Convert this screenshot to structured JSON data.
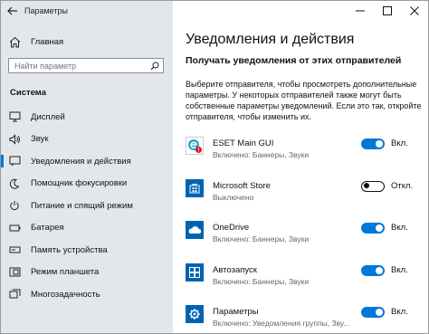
{
  "window": {
    "title": "Параметры"
  },
  "sidebar": {
    "home_label": "Главная",
    "search_placeholder": "Найти параметр",
    "section_title": "Система",
    "items": [
      {
        "label": "Дисплей",
        "icon": "display-icon",
        "active": false
      },
      {
        "label": "Звук",
        "icon": "sound-icon",
        "active": false
      },
      {
        "label": "Уведомления и действия",
        "icon": "notifications-icon",
        "active": true
      },
      {
        "label": "Помощник фокусировки",
        "icon": "focus-assist-icon",
        "active": false
      },
      {
        "label": "Питание и спящий режим",
        "icon": "power-icon",
        "active": false
      },
      {
        "label": "Батарея",
        "icon": "battery-icon",
        "active": false
      },
      {
        "label": "Память устройства",
        "icon": "storage-icon",
        "active": false
      },
      {
        "label": "Режим планшета",
        "icon": "tablet-mode-icon",
        "active": false
      },
      {
        "label": "Многозадачность",
        "icon": "multitasking-icon",
        "active": false
      }
    ]
  },
  "main": {
    "title": "Уведомления и действия",
    "subtitle": "Получать уведомления от этих отправителей",
    "description": "Выберите отправителя, чтобы просмотреть дополнительные параметры. У некоторых отправителей также могут быть собственные параметры уведомлений. Если это так, откройте отправителя, чтобы изменить их.",
    "apps": [
      {
        "name": "ESET Main GUI",
        "status": "Включено: Баннеры, Звуки",
        "toggle": "Вкл.",
        "on": true,
        "icon": "eset-icon"
      },
      {
        "name": "Microsoft Store",
        "status": "Выключено",
        "toggle": "Откл.",
        "on": false,
        "icon": "store-icon"
      },
      {
        "name": "OneDrive",
        "status": "Включено: Баннеры, Звуки",
        "toggle": "Вкл.",
        "on": true,
        "icon": "onedrive-icon"
      },
      {
        "name": "Автозапуск",
        "status": "Включено: Баннеры, Звуки",
        "toggle": "Вкл.",
        "on": true,
        "icon": "autoplay-icon"
      },
      {
        "name": "Параметры",
        "status": "Включено: Уведомления группы, Зву...",
        "toggle": "Вкл.",
        "on": true,
        "icon": "settings-icon"
      }
    ]
  },
  "colors": {
    "accent": "#0078d7",
    "sidebar_bg": "#e3e7ec",
    "app_tile": "#0063b1"
  }
}
